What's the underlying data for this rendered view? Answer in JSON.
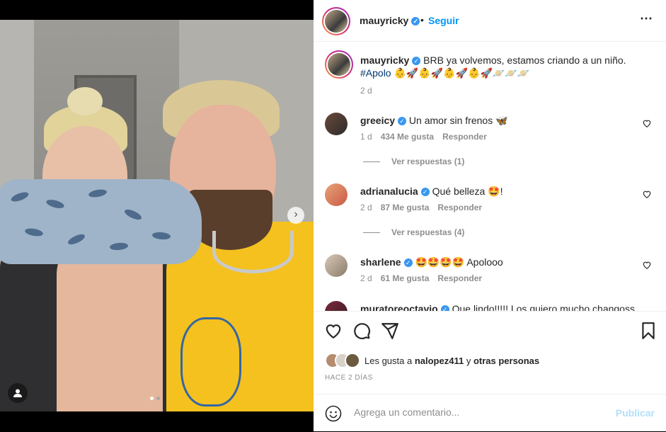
{
  "post": {
    "username": "mauyricky",
    "follow_label": "Seguir",
    "more_icon": "⋯",
    "separator": "•"
  },
  "caption": {
    "username": "mauyricky",
    "text": " BRB ya volvemos, estamos criando a un niño.",
    "hashtag": "#Apolo",
    "emojis": " 👶🚀👶🚀👶🚀👶🚀🪐🪐🪐",
    "time": "2 d"
  },
  "comments": [
    {
      "username": "greeicy",
      "text": " Un amor sin frenos 🦋",
      "time": "1 d",
      "likes": "434 Me gusta",
      "reply": "Responder",
      "view_replies": "Ver respuestas (1)"
    },
    {
      "username": "adrianalucia",
      "text": " Qué belleza 🤩!",
      "time": "2 d",
      "likes": "87 Me gusta",
      "reply": "Responder",
      "view_replies": "Ver respuestas (4)"
    },
    {
      "username": "sharlene",
      "text": " 🤩🤩🤩🤩 Apolooo",
      "time": "2 d",
      "likes": "61 Me gusta",
      "reply": "Responder"
    },
    {
      "username": "muratoreoctavio",
      "text": " Que lindo!!!!! Los quiero mucho changoss"
    }
  ],
  "likes_summary": {
    "prefix": "Les gusta a ",
    "user": "nalopez411",
    "middle": " y ",
    "others": "otras personas"
  },
  "timestamp": "HACE 2 DÍAS",
  "composer": {
    "placeholder": "Agrega un comentario...",
    "publish_label": "Publicar"
  },
  "carousel": {
    "total": 2,
    "active": 0
  },
  "colors": {
    "accent": "#0095f6",
    "verified": "#3897f0",
    "publish_disabled": "#b2dffc"
  }
}
